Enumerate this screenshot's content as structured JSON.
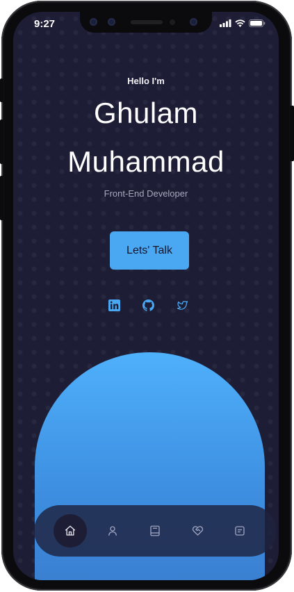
{
  "status_bar": {
    "time": "9:27"
  },
  "hero": {
    "greeting": "Hello I'm",
    "name_line1": "Ghulam",
    "name_line2": "Muhammad",
    "role": "Front-End Developer",
    "cta_label": "Lets' Talk"
  },
  "socials": [
    {
      "icon": "linkedin-icon"
    },
    {
      "icon": "github-icon"
    },
    {
      "icon": "twitter-icon"
    }
  ],
  "nav": {
    "active_index": 0,
    "items": [
      {
        "icon": "home-icon"
      },
      {
        "icon": "user-icon"
      },
      {
        "icon": "book-icon"
      },
      {
        "icon": "heart-handshake-icon"
      },
      {
        "icon": "message-icon"
      }
    ]
  },
  "colors": {
    "background": "#1d1d36",
    "accent": "#4aa8f3",
    "social_icon": "#4aa8f3"
  }
}
